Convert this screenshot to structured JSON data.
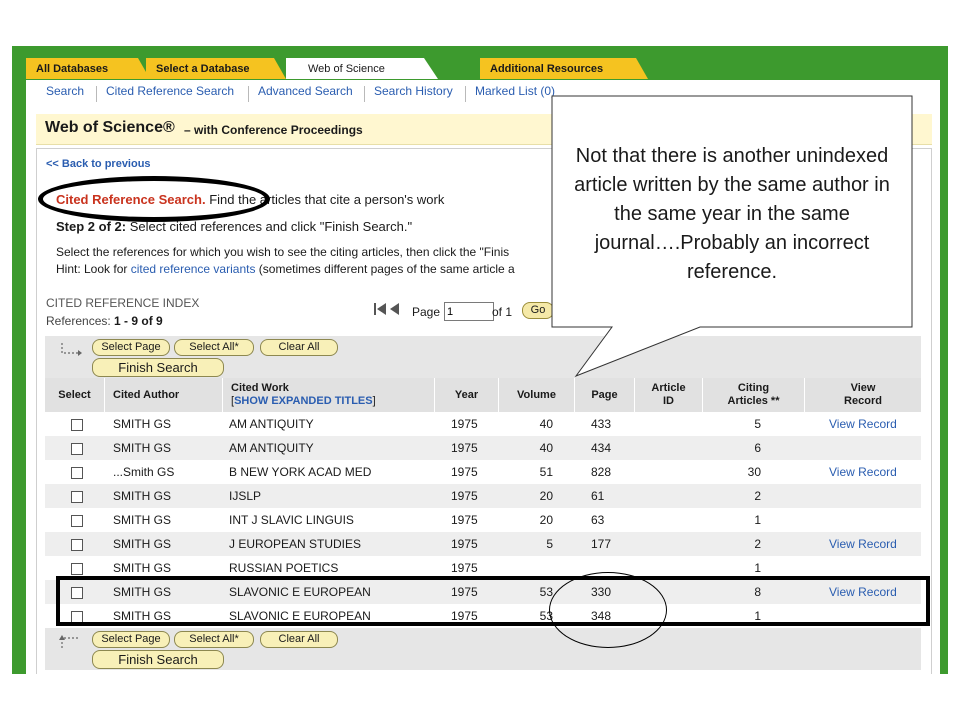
{
  "tabs": {
    "all_databases": "All Databases",
    "select_database": "Select a Database",
    "web_of_science": "Web of Science",
    "additional_resources": "Additional Resources"
  },
  "subnav": {
    "search": "Search",
    "cited_reference_search": "Cited Reference Search",
    "advanced_search": "Advanced Search",
    "search_history": "Search History",
    "marked_list": "Marked List (0)"
  },
  "header": {
    "title": "Web of Science®",
    "subtitle": "– with Conference Proceedings"
  },
  "back_link": "<< Back to previous",
  "cited_ref": {
    "title": "Cited Reference Search.",
    "description": "Find the articles that cite a person's work"
  },
  "step": {
    "label": "Step 2 of 2:",
    "text": "Select cited references and click \"Finish Search.\""
  },
  "instructions": {
    "select_text": "Select the references for which you wish to see the citing articles, then click the \"Finis",
    "hint_prefix": "Hint: Look for",
    "hint_link": "cited reference variants",
    "hint_suffix": "(sometimes different pages of the same article a"
  },
  "index": {
    "label": "CITED REFERENCE INDEX",
    "references_label": "References:",
    "references_value": "1 - 9 of  9"
  },
  "pager": {
    "first_icon": "first-page-icon",
    "page_label": "Page",
    "page_value": "1",
    "of_label": "of 1",
    "go_label": "Go"
  },
  "buttons": {
    "select_page": "Select Page",
    "select_all": "Select All*",
    "clear_all": "Clear All",
    "finish_search": "Finish Search"
  },
  "table": {
    "headers": {
      "select": "Select",
      "cited_author": "Cited Author",
      "cited_work": "Cited Work",
      "show_expanded": "SHOW EXPANDED TITLES",
      "year": "Year",
      "volume": "Volume",
      "page": "Page",
      "article_id_1": "Article",
      "article_id_2": "ID",
      "citing_1": "Citing",
      "citing_2": "Articles **",
      "view_1": "View",
      "view_2": "Record"
    },
    "rows": [
      {
        "author": "SMITH GS",
        "work": "AM ANTIQUITY",
        "year": "1975",
        "volume": "40",
        "page": "433",
        "article_id": "",
        "citing": "5",
        "view": "View Record"
      },
      {
        "author": "SMITH GS",
        "work": "AM ANTIQUITY",
        "year": "1975",
        "volume": "40",
        "page": "434",
        "article_id": "",
        "citing": "6",
        "view": ""
      },
      {
        "author": "...Smith GS",
        "work": "B NEW YORK ACAD MED",
        "year": "1975",
        "volume": "51",
        "page": "828",
        "article_id": "",
        "citing": "30",
        "view": "View Record"
      },
      {
        "author": "SMITH GS",
        "work": "IJSLP",
        "year": "1975",
        "volume": "20",
        "page": "61",
        "article_id": "",
        "citing": "2",
        "view": ""
      },
      {
        "author": "SMITH GS",
        "work": "INT J SLAVIC LINGUIS",
        "year": "1975",
        "volume": "20",
        "page": "63",
        "article_id": "",
        "citing": "1",
        "view": ""
      },
      {
        "author": "SMITH GS",
        "work": "J EUROPEAN STUDIES",
        "year": "1975",
        "volume": "5",
        "page": "177",
        "article_id": "",
        "citing": "2",
        "view": "View Record"
      },
      {
        "author": "SMITH GS",
        "work": "RUSSIAN POETICS",
        "year": "1975",
        "volume": "",
        "page": "",
        "article_id": "",
        "citing": "1",
        "view": ""
      },
      {
        "author": "SMITH GS",
        "work": "SLAVONIC E EUROPEAN",
        "year": "1975",
        "volume": "53",
        "page": "330",
        "article_id": "",
        "citing": "8",
        "view": "View Record"
      },
      {
        "author": "SMITH GS",
        "work": "SLAVONIC E EUROPEAN",
        "year": "1975",
        "volume": "53",
        "page": "348",
        "article_id": "",
        "citing": "1",
        "view": ""
      }
    ]
  },
  "callout": {
    "text": "Not that there is another unindexed article written by the same author in the same year in the same journal….Probably an incorrect reference."
  },
  "colors": {
    "frame_green": "#3d9a2e",
    "tab_yellow": "#f5c320",
    "link_blue": "#2a5db0",
    "highlight_red": "#c9331e"
  }
}
